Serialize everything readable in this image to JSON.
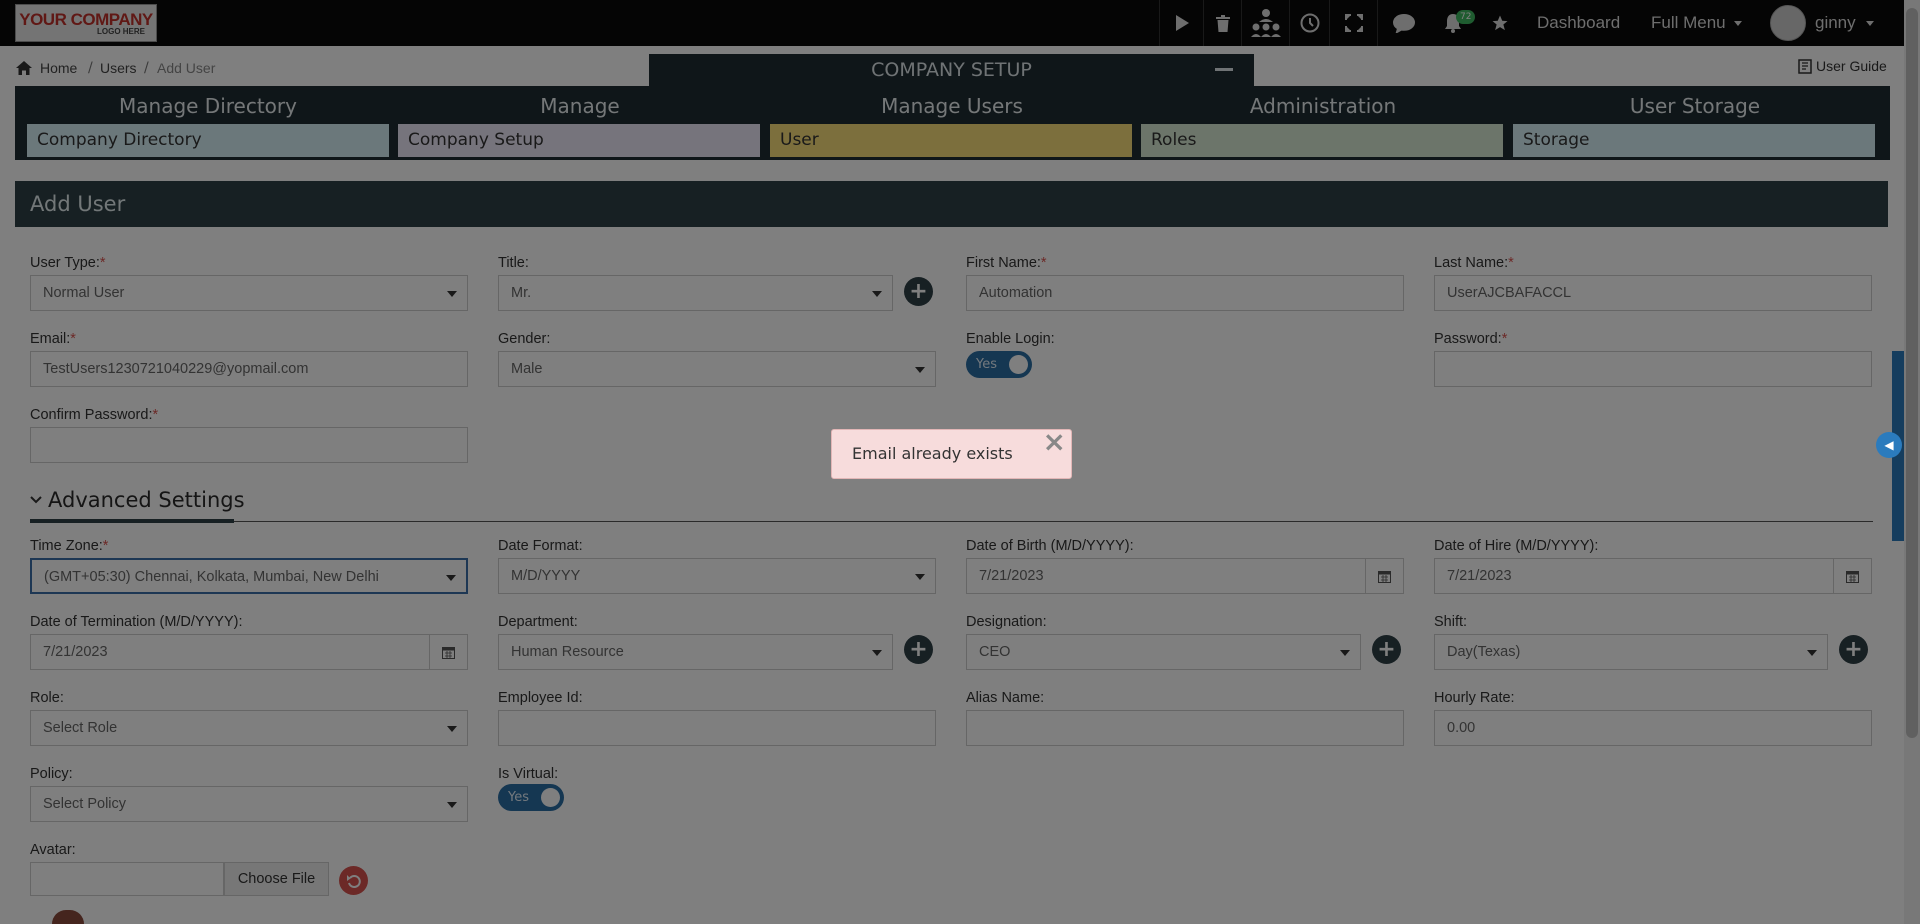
{
  "topnav": {
    "logo_line1": "YOUR COMPANY",
    "logo_line2": "LOGO HERE",
    "notification_count": "72",
    "dashboard": "Dashboard",
    "full_menu": "Full Menu",
    "username": "ginny"
  },
  "breadcrumb": {
    "home": "Home",
    "users": "Users",
    "current": "Add User",
    "sep": "/"
  },
  "user_guide": "User Guide",
  "company_setup": {
    "title": "COMPANY SETUP",
    "columns": [
      {
        "title": "Manage Directory",
        "card": "Company Directory",
        "color": "#d7f0f7"
      },
      {
        "title": "Manage",
        "card": "Company Setup",
        "color": "#ece8f8"
      },
      {
        "title": "Manage Users",
        "card": "User",
        "color": "#f9df7a"
      },
      {
        "title": "Administration",
        "card": "Roles",
        "color": "#d8ebd5"
      },
      {
        "title": "User Storage",
        "card": "Storage",
        "color": "#d7f0f7"
      }
    ]
  },
  "form": {
    "header": "Add User",
    "required_mark": "*",
    "user_type": {
      "label": "User Type:",
      "value": "Normal User"
    },
    "title": {
      "label": "Title:",
      "value": "Mr."
    },
    "first_name": {
      "label": "First Name:",
      "value": "Automation"
    },
    "last_name": {
      "label": "Last Name:",
      "value": "UserAJCBAFACCL"
    },
    "email": {
      "label": "Email:",
      "value": "TestUsers1230721040229@yopmail.com"
    },
    "gender": {
      "label": "Gender:",
      "value": "Male"
    },
    "enable_login": {
      "label": "Enable Login:",
      "value": "Yes"
    },
    "password": {
      "label": "Password:",
      "value": ""
    },
    "confirm_password": {
      "label": "Confirm Password:",
      "value": ""
    },
    "advanced_settings": "Advanced Settings",
    "time_zone": {
      "label": "Time Zone:",
      "value": "(GMT+05:30) Chennai, Kolkata, Mumbai, New Delhi"
    },
    "date_format": {
      "label": "Date Format:",
      "value": "M/D/YYYY"
    },
    "date_of_birth": {
      "label": "Date of Birth (M/D/YYYY):",
      "value": "7/21/2023"
    },
    "date_of_hire": {
      "label": "Date of Hire (M/D/YYYY):",
      "value": "7/21/2023"
    },
    "date_of_termination": {
      "label": "Date of Termination (M/D/YYYY):",
      "value": "7/21/2023"
    },
    "department": {
      "label": "Department:",
      "value": "Human Resource"
    },
    "designation": {
      "label": "Designation:",
      "value": "CEO"
    },
    "shift": {
      "label": "Shift:",
      "value": "Day(Texas)"
    },
    "role": {
      "label": "Role:",
      "value": "Select Role"
    },
    "employee_id": {
      "label": "Employee Id:",
      "value": ""
    },
    "alias_name": {
      "label": "Alias Name:",
      "value": ""
    },
    "hourly_rate": {
      "label": "Hourly Rate:",
      "value": "0.00"
    },
    "policy": {
      "label": "Policy:",
      "value": "Select Policy"
    },
    "is_virtual": {
      "label": "Is Virtual:",
      "value": "Yes"
    },
    "avatar": {
      "label": "Avatar:",
      "choose_file": "Choose File"
    }
  },
  "toast": {
    "message": "Email already exists",
    "close": "×"
  }
}
